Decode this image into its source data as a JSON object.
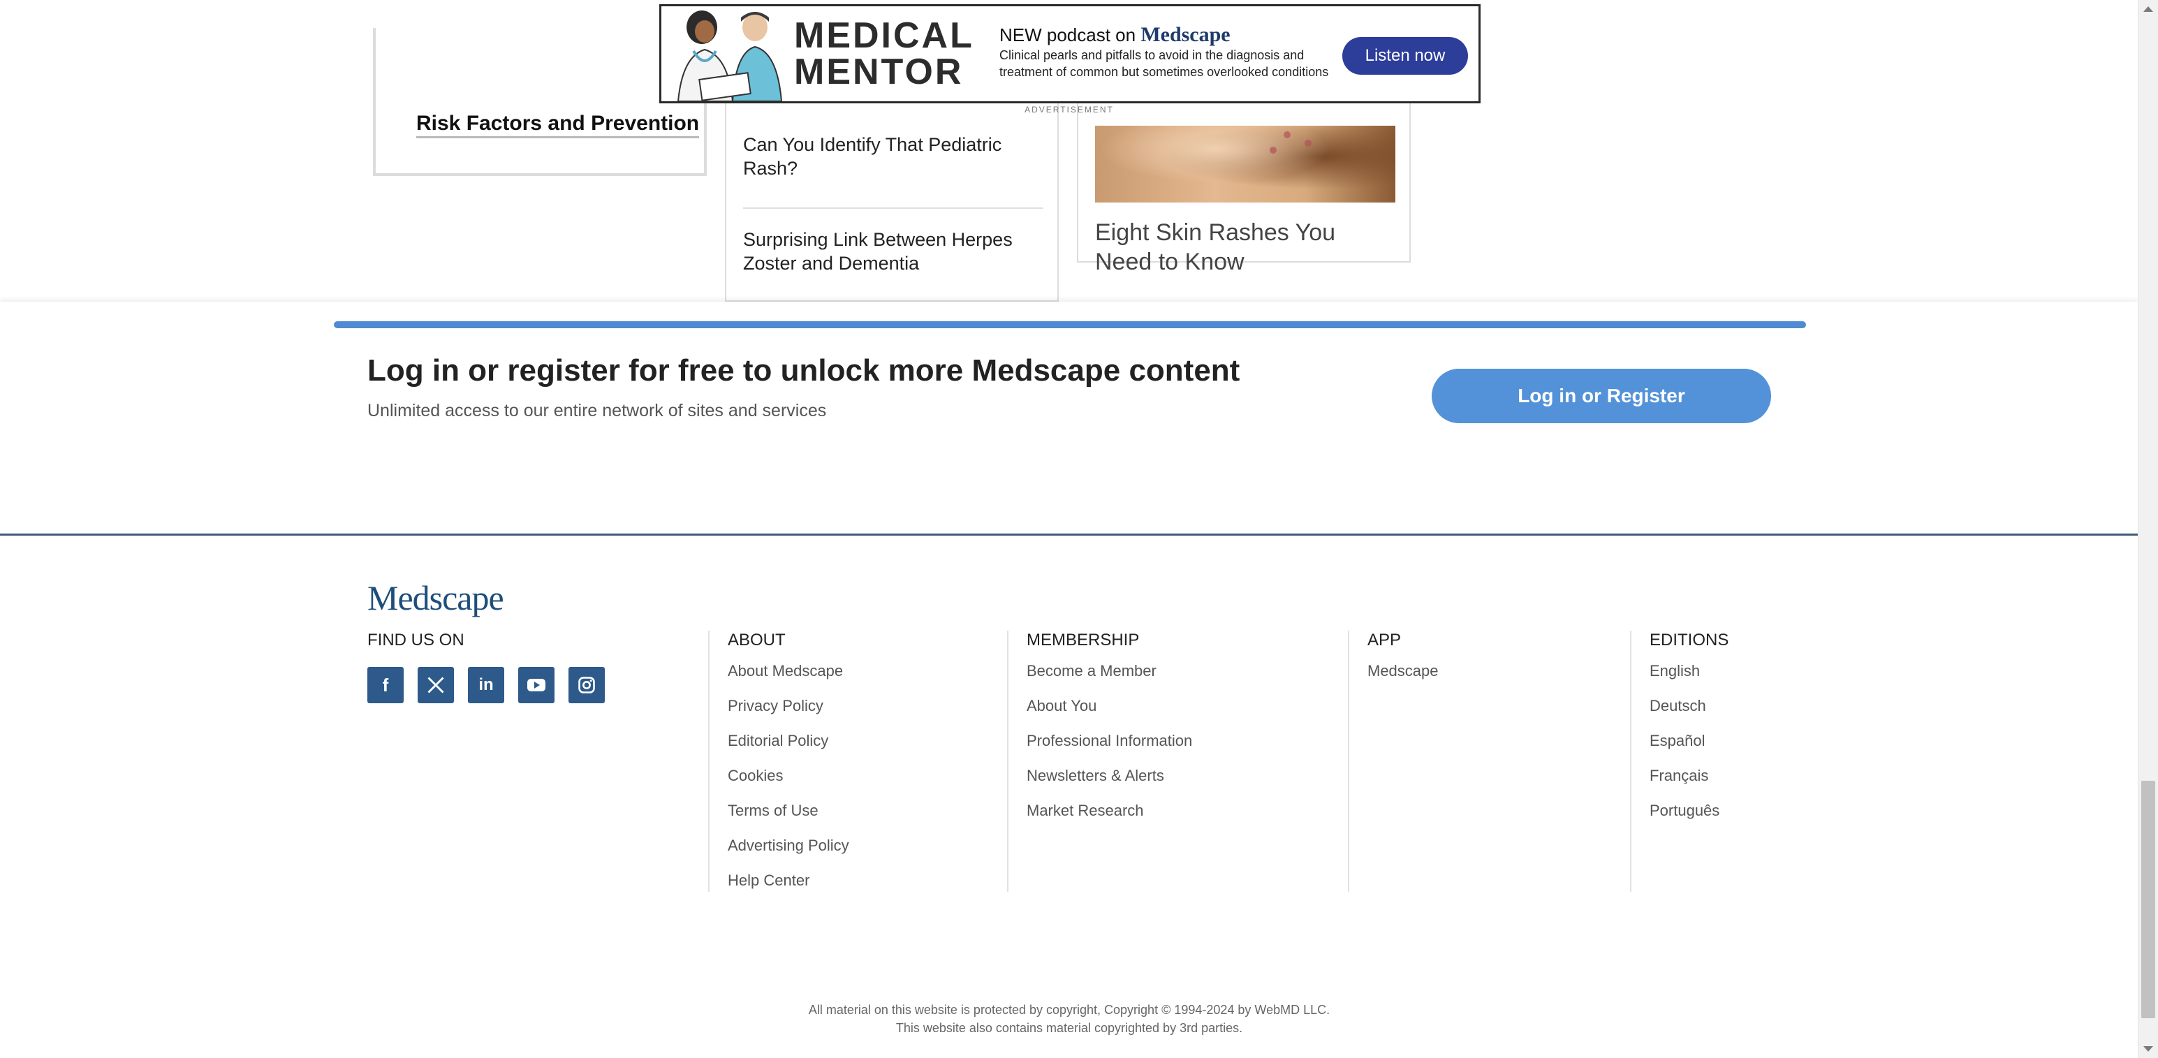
{
  "cards": {
    "left_title": "Risk Factors and Prevention",
    "mid_links": [
      "Can You Identify That Pediatric Rash?",
      "Surprising Link Between Herpes Zoster and Dementia"
    ],
    "right_caption": "Eight Skin Rashes You Need to Know"
  },
  "ad": {
    "brand_line1": "MEDICAL",
    "brand_line2": "MENTOR",
    "headline_prefix": "NEW podcast on ",
    "headline_brand": "Medscape",
    "description": "Clinical pearls and pitfalls to avoid in the diagnosis and treatment of common but sometimes overlooked conditions",
    "cta": "Listen now",
    "label": "ADVERTISEMENT",
    "accent": "#2c3d9a"
  },
  "register": {
    "heading": "Log in or register for free to unlock more Medscape content",
    "subheading": "Unlimited access to our entire network of sites and services",
    "button": "Log in or Register",
    "accent": "#5392d8"
  },
  "footer": {
    "logo": "Medscape",
    "find_us": "FIND US ON",
    "socials": [
      "facebook-icon",
      "x-icon",
      "linkedin-icon",
      "youtube-icon",
      "instagram-icon"
    ],
    "about": {
      "heading": "ABOUT",
      "links": [
        "About Medscape",
        "Privacy Policy",
        "Editorial Policy",
        "Cookies",
        "Terms of Use",
        "Advertising Policy",
        "Help Center"
      ]
    },
    "membership": {
      "heading": "MEMBERSHIP",
      "links": [
        "Become a Member",
        "About You",
        "Professional Information",
        "Newsletters & Alerts",
        "Market Research"
      ]
    },
    "app": {
      "heading": "APP",
      "links": [
        "Medscape"
      ]
    },
    "editions": {
      "heading": "EDITIONS",
      "links": [
        "English",
        "Deutsch",
        "Español",
        "Français",
        "Português"
      ]
    },
    "copyright_line1": "All material on this website is protected by copyright, Copyright © 1994-2024 by WebMD LLC.",
    "copyright_line2": "This website also contains material copyrighted by 3rd parties."
  }
}
